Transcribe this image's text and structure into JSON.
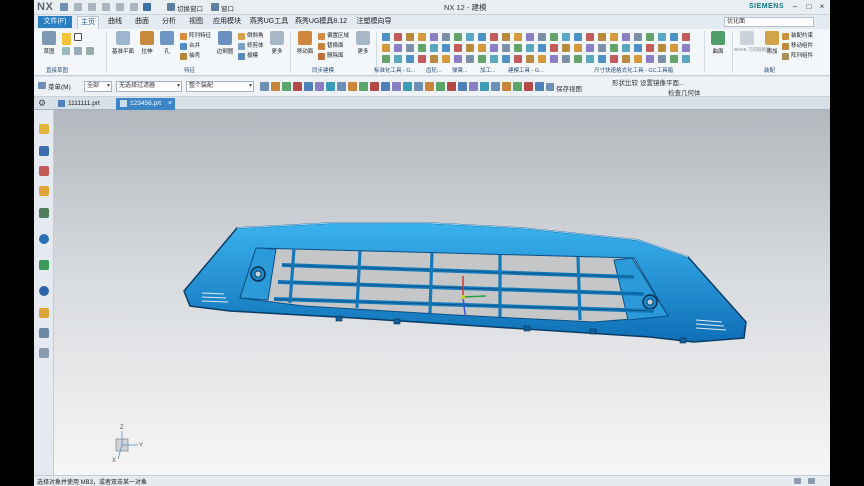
{
  "titlebar": {
    "logo": "NX",
    "switch_window_label": "切换窗口",
    "window_menu_label": "窗口",
    "window_title": "NX 12 - 建模",
    "brand": "SIEMENS",
    "minimize": "–",
    "maximize": "□",
    "close": "×"
  },
  "menubar": {
    "file_label": "文件(F)",
    "tabs": [
      "主页",
      "曲线",
      "曲面",
      "分析",
      "视图",
      "应用模块",
      "燕秀UG工具",
      "燕秀UG模具8.12",
      "注塑模向导"
    ],
    "active_tab": "主页",
    "search_placeholder": "优化面"
  },
  "ribbon": {
    "sketch_group": {
      "sketch": "草图",
      "label": "直接草图"
    },
    "feature_group": {
      "datum_plane": "基准平面",
      "extrude": "拉伸",
      "hole": "孔",
      "pattern_feature": "阵列特征",
      "unite": "合并",
      "shell": "抽壳",
      "edge_blend": "边倒圆",
      "chamfer": "倒斜角",
      "trim_body": "修剪体",
      "draft": "拔模",
      "more": "更多",
      "label": "特征"
    },
    "sync_group": {
      "move_face": "移动面",
      "offset_region": "偏置区域",
      "replace_face": "替换面",
      "delete_face": "删除面",
      "more": "更多",
      "label": "同步建模"
    },
    "tool_groups": [
      "标准化工具 - G...",
      "齿轮...",
      "弹簧...",
      "加工...",
      "建模工具 - G...",
      "尺寸快速格式化工具 - GC工具箱"
    ],
    "surface_group": {
      "surface": "曲面"
    },
    "assembly_group": {
      "wave_geometry": "WAVE 几何链接器",
      "add": "添加",
      "assembly_constraints": "装配约束",
      "move_component": "移动组件",
      "array_component": "阵列组件",
      "label": "装配"
    }
  },
  "toolbar2": {
    "menu_label": "菜单(M)",
    "filter_all": "全部",
    "selection_filter": "无选择过滤器",
    "scope": "整个装配",
    "save_view": "保存视图",
    "set_mirror_plane": "设置镜像平面...",
    "shape_compare": "形状比较",
    "check_geometry": "检查几何体"
  },
  "tabs": [
    {
      "label": "1111111.prt",
      "active": false
    },
    {
      "label": "123456.prt",
      "active": true
    }
  ],
  "triad": {
    "x": "X",
    "y": "Y",
    "z": "Z"
  },
  "status": {
    "message": "选择对象并使用 MB3，或者双击某一对象"
  }
}
